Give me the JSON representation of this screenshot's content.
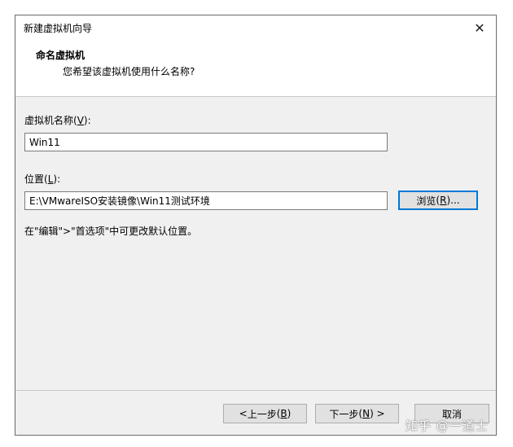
{
  "window": {
    "title": "新建虚拟机向导"
  },
  "header": {
    "title": "命名虚拟机",
    "subtitle": "您希望该虚拟机使用什么名称?"
  },
  "name_field": {
    "label": "虚拟机名称",
    "hotkey": "V",
    "value": "Win11"
  },
  "location_field": {
    "label": "位置",
    "hotkey": "L",
    "value": "E:\\VMwareISO安装镜像\\Win11测试环境"
  },
  "browse_button": {
    "label": "浏览",
    "hotkey": "R",
    "suffix": "..."
  },
  "hint": "在\"编辑\">\"首选项\"中可更改默认位置。",
  "footer": {
    "back_label": "上一步",
    "back_hotkey": "B",
    "next_label": "下一步",
    "next_hotkey": "N",
    "cancel_label": "取消"
  },
  "watermark": "知乎 @一道士",
  "icons": {
    "close": "close-icon"
  }
}
